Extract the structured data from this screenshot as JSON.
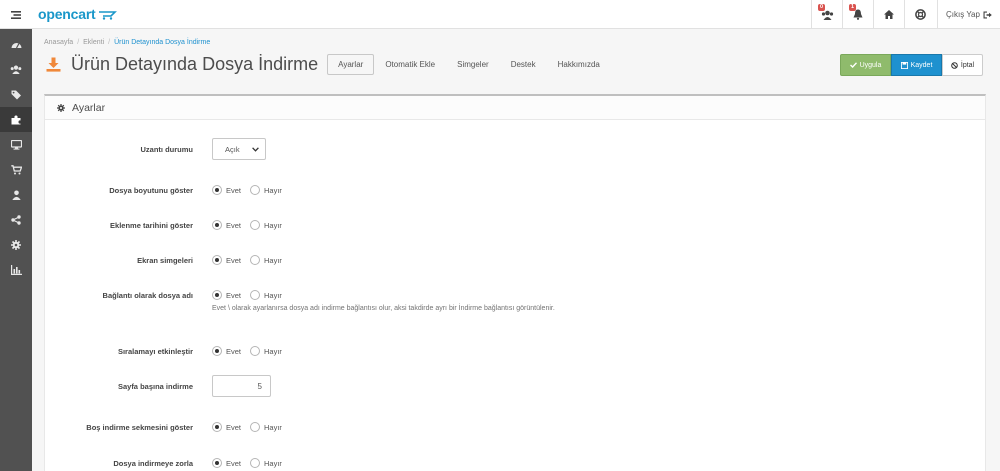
{
  "header": {
    "logo_text": "opencart",
    "badge_customers": "0",
    "badge_alerts": "1",
    "logout_label": "Çıkış Yap"
  },
  "breadcrumb": [
    "Anasayfa",
    "Eklenti",
    "Ürün Detayında Dosya İndirme"
  ],
  "page": {
    "title": "Ürün Detayında Dosya İndirme",
    "tabs": [
      "Ayarlar",
      "Otomatik Ekle",
      "Simgeler",
      "Destek",
      "Hakkımızda"
    ]
  },
  "actions": {
    "apply": "Uygula",
    "save": "Kaydet",
    "cancel": "İptal"
  },
  "panel": {
    "heading": "Ayarlar"
  },
  "form": {
    "yes": "Evet",
    "no": "Hayır",
    "status_label": "Uzantı durumu",
    "status_value": "Açık",
    "show_size_label": "Dosya boyutunu göster",
    "show_date_label": "Eklenme tarihini göster",
    "screen_icons_label": "Ekran simgeleri",
    "link_name_label": "Bağlantı olarak dosya adı",
    "link_name_help": "Evet \\ olarak ayarlanırsa dosya adı indirme bağlantısı olur, aksi takdirde ayrı bir İndirme bağlantısı görüntülenir.",
    "sorting_label": "Sıralamayı etkinleştir",
    "per_page_label": "Sayfa başına indirme",
    "per_page_value": "5",
    "empty_tab_label": "Boş indirme sekmesini göster",
    "force_label": "Dosya indirmeye zorla"
  }
}
